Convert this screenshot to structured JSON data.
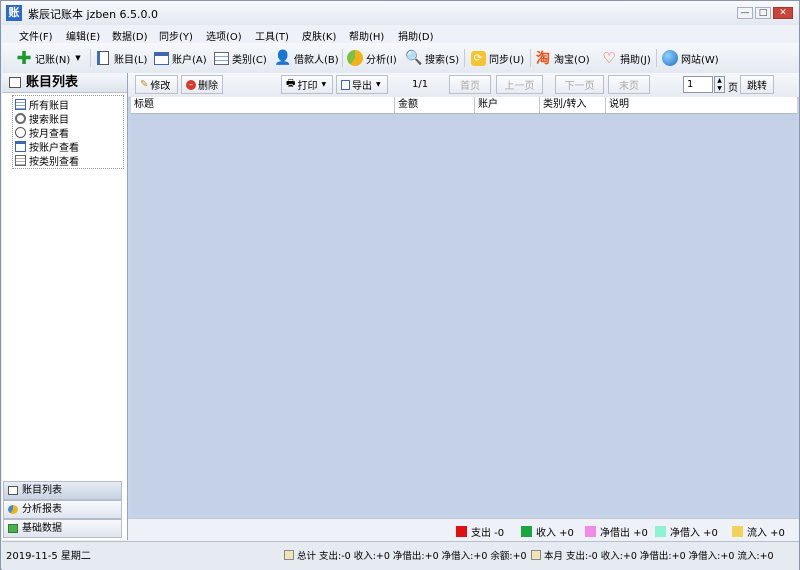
{
  "window": {
    "title": "紫辰记账本  jzben  6.5.0.0",
    "app_icon_text": "账",
    "controls": {
      "minimize": "—",
      "maximize": "□",
      "close": "✕"
    }
  },
  "menu": [
    "文件(F)",
    "编辑(E)",
    "数据(D)",
    "同步(Y)",
    "选项(O)",
    "工具(T)",
    "皮肤(K)",
    "帮助(H)",
    "捐助(D)"
  ],
  "toolbar": {
    "record": "记账(N)",
    "accounts": "账目(L)",
    "account": "账户(A)",
    "category": "类别(C)",
    "borrower": "借款人(B)",
    "analysis": "分析(I)",
    "search": "搜索(S)",
    "sync": "同步(U)",
    "taobao": "淘宝(O)",
    "donate": "捐助(J)",
    "website": "网站(W)"
  },
  "sidebar": {
    "title": "账目列表",
    "tree": [
      "所有账目",
      "搜索账目",
      "按月查看",
      "按账户查看",
      "按类别查看"
    ],
    "nav": [
      "账目列表",
      "分析报表",
      "基础数据"
    ]
  },
  "subtoolbar": {
    "edit": "修改",
    "delete": "删除",
    "print": "打印",
    "export": "导出",
    "page_info": "1/1",
    "first": "首页",
    "prev": "上一页",
    "next": "下一页",
    "last": "末页",
    "page_value": "1",
    "page_unit": "页",
    "jump": "跳转"
  },
  "grid": {
    "columns": [
      "标题",
      "金额",
      "账户",
      "类别/转入",
      "说明"
    ]
  },
  "legend": [
    {
      "label": "支出 -0",
      "color": "#e01010"
    },
    {
      "label": "收入 +0",
      "color": "#1aa640"
    },
    {
      "label": "净借出 +0",
      "color": "#f08ce8"
    },
    {
      "label": "净借入 +0",
      "color": "#8ef2d4"
    },
    {
      "label": "流入 +0",
      "color": "#f3d25a"
    }
  ],
  "status": {
    "date": "2019-11-5 星期二",
    "total": "总计 支出:-0  收入:+0  净借出:+0  净借入:+0  余额:+0",
    "month": "本月 支出:-0  收入:+0  净借出:+0  净借入:+0  流入:+0"
  }
}
